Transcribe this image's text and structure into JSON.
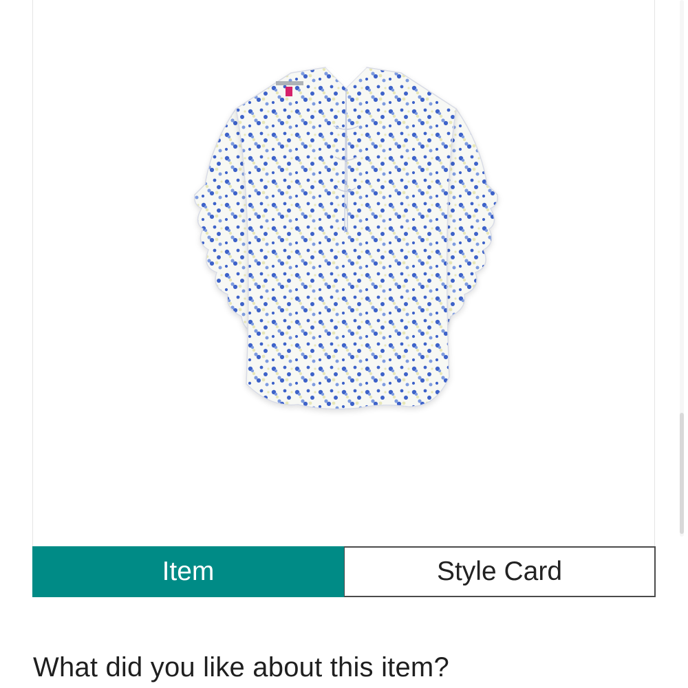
{
  "product": {
    "image_alt": "white blouse with blue floral print and ruffled sleeves",
    "print_colors": {
      "fabric": "#f7f8f4",
      "flower": "#3d62c9",
      "flower_light": "#7d9be0",
      "accent": "#e7e7b8",
      "tag": "#d6226a"
    }
  },
  "tabs": {
    "item_label": "Item",
    "style_card_label": "Style Card",
    "active_color": "#008b86"
  },
  "feedback": {
    "question": "What did you like about this item?"
  }
}
